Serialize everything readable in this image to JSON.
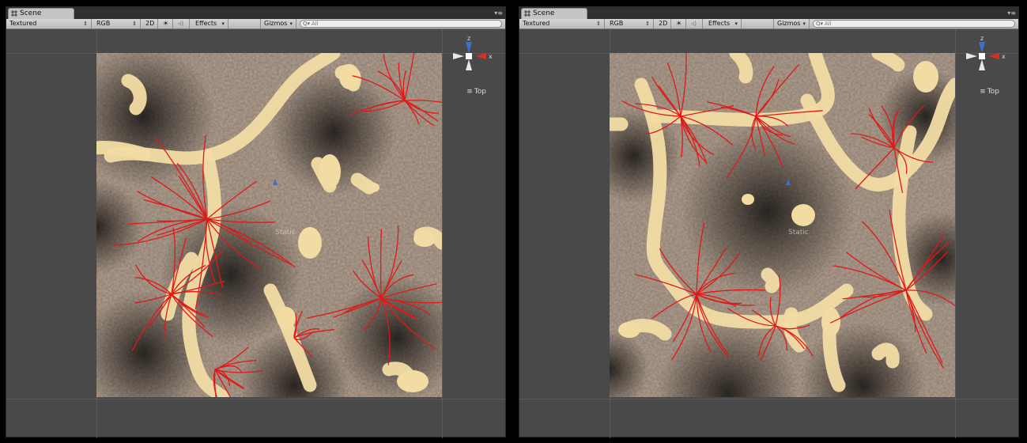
{
  "panels": [
    {
      "tab_label": "Scene",
      "render_mode": "Textured",
      "color_mode": "RGB",
      "toggle_2d": "2D",
      "effects_label": "Effects",
      "gizmos_label": "Gizmos",
      "search_placeholder": "All",
      "axis_z": "z",
      "axis_x": "x",
      "view_label": "Top",
      "overlay_text": "Static"
    },
    {
      "tab_label": "Scene",
      "render_mode": "Textured",
      "color_mode": "RGB",
      "toggle_2d": "2D",
      "effects_label": "Effects",
      "gizmos_label": "Gizmos",
      "search_placeholder": "All",
      "axis_z": "z",
      "axis_x": "x",
      "view_label": "Top",
      "overlay_text": "Static"
    }
  ],
  "colors": {
    "background": "#494949",
    "toolbar": "#c6c6c6",
    "terrain_base": "#7a6858",
    "path_color": "#f2dca4",
    "vein_color": "#e01818",
    "axis_x_red": "#d8321e",
    "axis_z_blue": "#3b6fd8"
  },
  "icons": [
    "grid-icon",
    "menu-icon",
    "sun-icon",
    "speaker-icon",
    "search-icon",
    "view-gizmo-icon"
  ]
}
